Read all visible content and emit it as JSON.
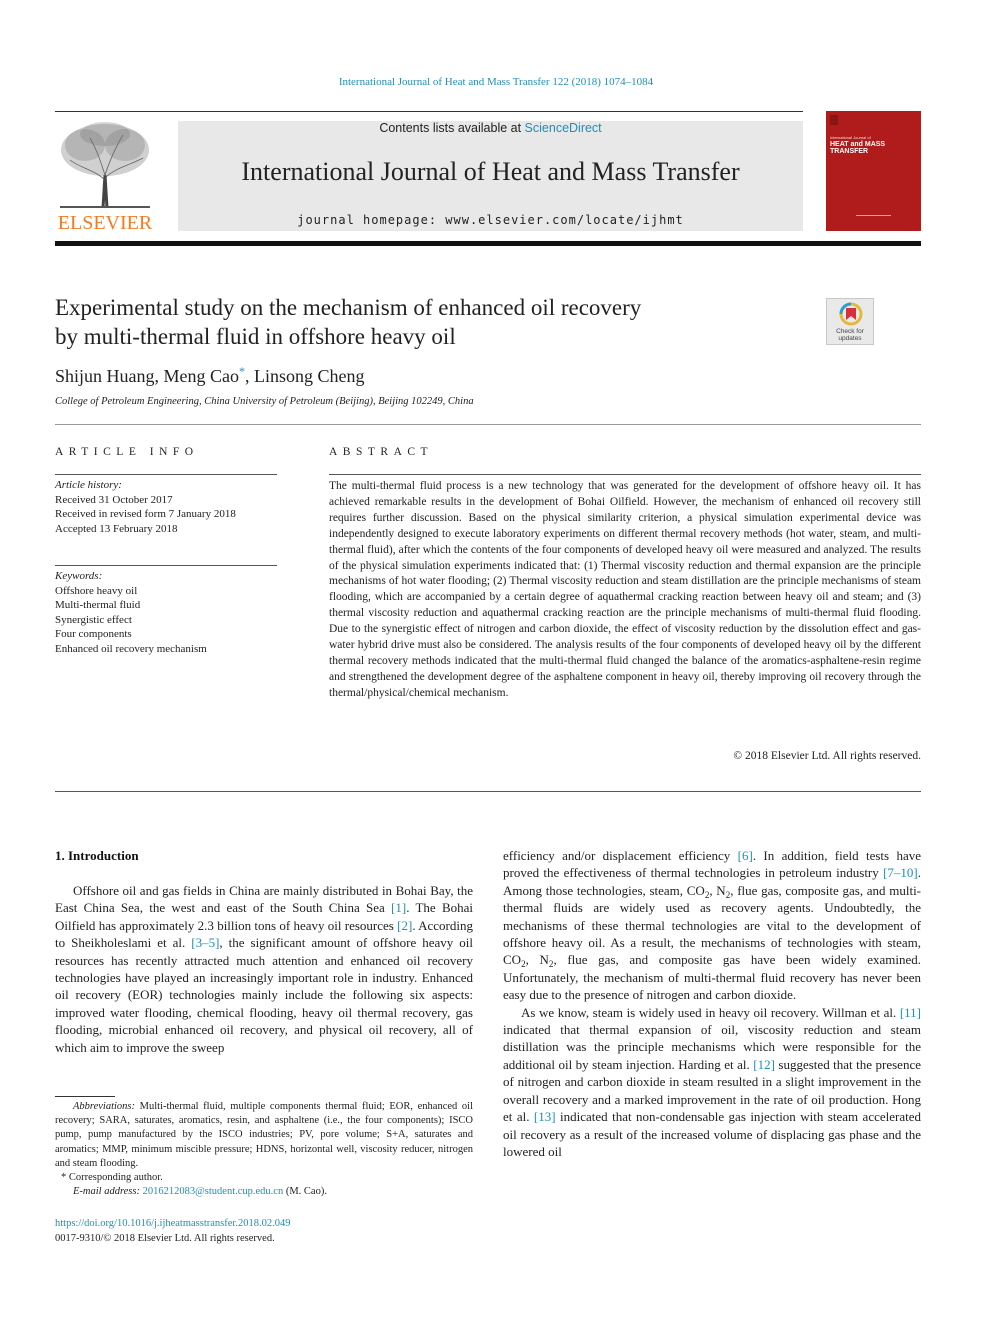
{
  "header": {
    "citation": "International Journal of Heat and Mass Transfer 122 (2018) 1074–1084",
    "contents_prefix": "Contents lists available at ",
    "contents_link": "ScienceDirect",
    "journal_name": "International Journal of Heat and Mass Transfer",
    "homepage_prefix": "journal homepage: ",
    "homepage_url": "www.elsevier.com/locate/ijhmt",
    "publisher_logo_text": "ELSEVIER",
    "cover": {
      "small_text": "International Journal of",
      "title_line1": "HEAT and MASS",
      "title_line2": "TRANSFER"
    },
    "colors": {
      "link": "#1f8fb6",
      "elsevier_orange": "#f47b20",
      "cover_red": "#b01c1c",
      "masthead_gray": "#e8e8e8"
    }
  },
  "article": {
    "title_line1": "Experimental study on the mechanism of enhanced oil recovery",
    "title_line2": "by multi-thermal fluid in offshore heavy oil",
    "check_updates_line1": "Check for",
    "check_updates_line2": "updates",
    "authors": {
      "author1": "Shijun Huang, ",
      "author2": "Meng Cao",
      "corresponding_mark": "*",
      "author3": ", Linsong Cheng"
    },
    "affiliation": "College of Petroleum Engineering, China University of Petroleum (Beijing), Beijing 102249, China"
  },
  "article_info": {
    "heading": "ARTICLE INFO",
    "history_label": "Article history:",
    "history": [
      "Received 31 October 2017",
      "Received in revised form 7 January 2018",
      "Accepted 13 February 2018"
    ],
    "keywords_label": "Keywords:",
    "keywords": [
      "Offshore heavy oil",
      "Multi-thermal fluid",
      "Synergistic effect",
      "Four components",
      "Enhanced oil recovery mechanism"
    ]
  },
  "abstract": {
    "heading": "ABSTRACT",
    "text": "The multi-thermal fluid process is a new technology that was generated for the development of offshore heavy oil. It has achieved remarkable results in the development of Bohai Oilfield. However, the mechanism of enhanced oil recovery still requires further discussion. Based on the physical similarity criterion, a physical simulation experimental device was independently designed to execute laboratory experiments on different thermal recovery methods (hot water, steam, and multi-thermal fluid), after which the contents of the four components of developed heavy oil were measured and analyzed. The results of the physical simulation experiments indicated that: (1) Thermal viscosity reduction and thermal expansion are the principle mechanisms of hot water flooding; (2) Thermal viscosity reduction and steam distillation are the principle mechanisms of steam flooding, which are accompanied by a certain degree of aquathermal cracking reaction between heavy oil and steam; and (3) thermal viscosity reduction and aquathermal cracking reaction are the principle mechanisms of multi-thermal fluid flooding. Due to the synergistic effect of nitrogen and carbon dioxide, the effect of viscosity reduction by the dissolution effect and gas-water hybrid drive must also be considered. The analysis results of the four components of developed heavy oil by the different thermal recovery methods indicated that the multi-thermal fluid changed the balance of the aromatics-asphaltene-resin regime and strengthened the development degree of the asphaltene component in heavy oil, thereby improving oil recovery through the thermal/physical/chemical mechanism.",
    "copyright": "© 2018 Elsevier Ltd. All rights reserved."
  },
  "introduction": {
    "heading": "1. Introduction",
    "p1": {
      "t1": "Offshore oil and gas fields in China are mainly distributed in Bohai Bay, the East China Sea, the west and east of the South China Sea ",
      "r1": "[1]",
      "t2": ". The Bohai Oilfield has approximately 2.3 billion tons of heavy oil resources ",
      "r2": "[2]",
      "t3": ". According to Sheikholeslami et al. ",
      "r3": "[3–5]",
      "t4": ", the significant amount of offshore heavy oil resources has recently attracted much attention and enhanced oil recovery technologies have played an increasingly important role in industry. Enhanced oil recovery (EOR) technologies mainly include the following six aspects: improved water flooding, chemical flooding, heavy oil thermal recovery, gas flooding, microbial enhanced oil recovery, and physical oil recovery, all of which aim to improve the sweep"
    },
    "p1_cont": {
      "t1": "efficiency and/or displacement efficiency ",
      "r1": "[6]",
      "t2": ". In addition, field tests have proved the effectiveness of thermal technologies in petroleum industry ",
      "r2": "[7–10]",
      "t3": ". Among those technologies, steam, CO",
      "s1": "2",
      "t4": ", N",
      "s2": "2",
      "t5": ", flue gas, composite gas, and multi-thermal fluids are widely used as recovery agents. Undoubtedly, the mechanisms of these thermal technologies are vital to the development of offshore heavy oil. As a result, the mechanisms of technologies with steam, CO",
      "s3": "2",
      "t6": ", N",
      "s4": "2",
      "t7": ", flue gas, and composite gas have been widely examined. Unfortunately, the mechanism of multi-thermal fluid recovery has never been easy due to the presence of nitrogen and carbon dioxide."
    },
    "p2": {
      "t1": "As we know, steam is widely used in heavy oil recovery. Willman et al. ",
      "r1": "[11]",
      "t2": " indicated that thermal expansion of oil, viscosity reduction and steam distillation was the principle mechanisms which were responsible for the additional oil by steam injection. Harding et al. ",
      "r2": "[12]",
      "t3": " suggested that the presence of nitrogen and carbon dioxide in steam resulted in a slight improvement in the overall recovery and a marked improvement in the rate of oil production. Hong et al. ",
      "r3": "[13]",
      "t4": " indicated that non-condensable gas injection with steam accelerated oil recovery as a result of the increased volume of displacing gas phase and the lowered oil"
    }
  },
  "footnotes": {
    "abbrev_label": "Abbreviations:",
    "abbrev_text": " Multi-thermal fluid, multiple components thermal fluid; EOR, enhanced oil recovery; SARA, saturates, aromatics, resin, and asphaltene (i.e., the four components); ISCO pump, pump manufactured by the ISCO industries; PV, pore volume; S+A, saturates and aromatics; MMP, minimum miscible pressure; HDNS, horizontal well, viscosity reducer, nitrogen and steam flooding.",
    "corresponding_mark": "*",
    "corresponding_text": " Corresponding author.",
    "email_label": "E-mail address:",
    "email": "2016212083@student.cup.edu.cn",
    "email_suffix": " (M. Cao)."
  },
  "bottom": {
    "doi_url": "https://doi.org/10.1016/j.ijheatmasstransfer.2018.02.049",
    "issn_line": "0017-9310/© 2018 Elsevier Ltd. All rights reserved."
  }
}
